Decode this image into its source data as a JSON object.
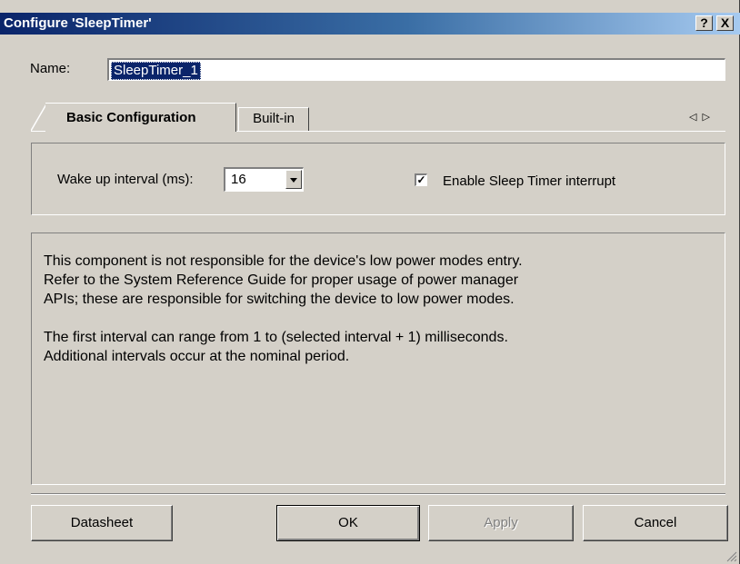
{
  "window": {
    "title": "Configure 'SleepTimer'",
    "help_button": "?",
    "close_button": "X"
  },
  "name_field": {
    "label": "Name:",
    "value": "SleepTimer_1"
  },
  "tabs": [
    {
      "label": "Basic Configuration",
      "active": true
    },
    {
      "label": "Built-in",
      "active": false
    }
  ],
  "tab_scroll": {
    "left": "◁",
    "right": "▷"
  },
  "settings": {
    "wake_label": "Wake up interval (ms):",
    "wake_value": "16",
    "interrupt_label": "Enable Sleep Timer interrupt",
    "interrupt_checked": true,
    "checkmark": "✓"
  },
  "description": {
    "para1": "This component is not responsible for the device's low power modes entry.\nRefer to the System Reference Guide for proper usage of power manager\nAPIs; these are responsible for switching the device to low power modes.",
    "para2": "The first interval can range from 1 to (selected interval + 1) milliseconds.\nAdditional intervals occur at the nominal period."
  },
  "buttons": {
    "datasheet": "Datasheet",
    "ok": "OK",
    "apply": "Apply",
    "cancel": "Cancel"
  }
}
